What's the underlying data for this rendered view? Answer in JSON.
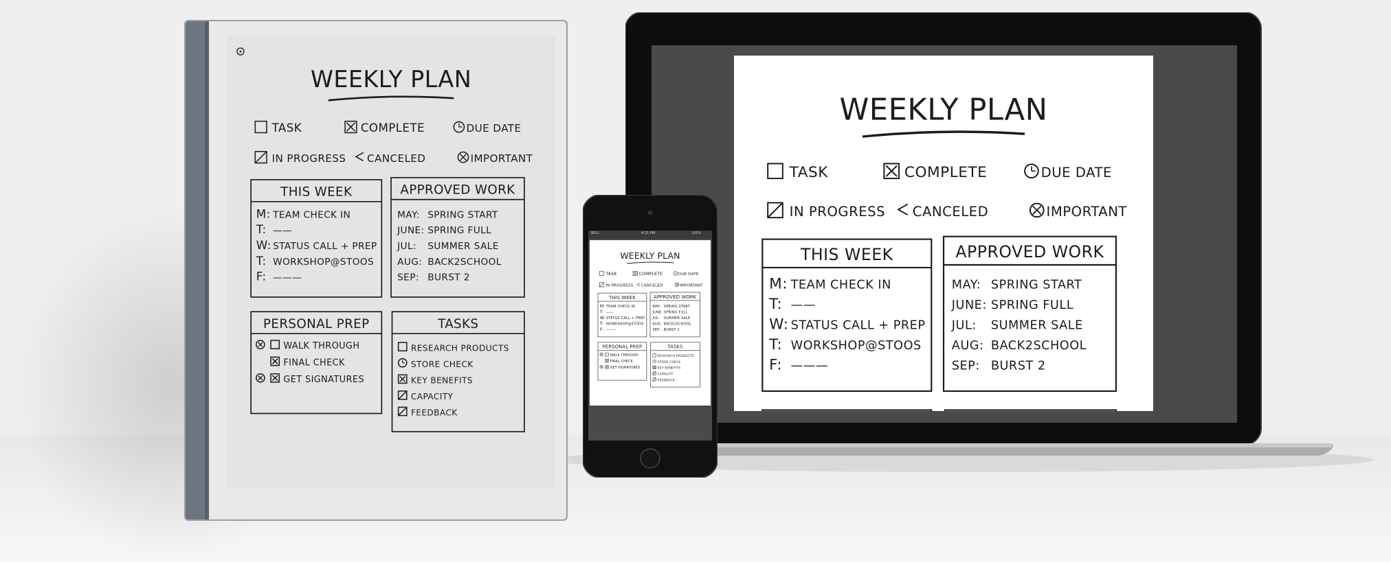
{
  "note": {
    "title": "WEEKLY PLAN",
    "legend": {
      "task": "TASK",
      "complete": "COMPLETE",
      "due_date": "DUE DATE",
      "in_progress": "IN PROGRESS",
      "canceled": "CANCELED",
      "important": "IMPORTANT"
    },
    "this_week": {
      "heading": "THIS WEEK",
      "rows": [
        {
          "day": "M:",
          "text": "TEAM CHECK IN"
        },
        {
          "day": "T:",
          "text": "——"
        },
        {
          "day": "W:",
          "text": "STATUS CALL + PREP"
        },
        {
          "day": "T:",
          "text": "WORKSHOP@STOOS"
        },
        {
          "day": "F:",
          "text": "———"
        }
      ]
    },
    "approved_work": {
      "heading": "APPROVED WORK",
      "rows": [
        {
          "month": "MAY:",
          "text": "SPRING START"
        },
        {
          "month": "JUNE:",
          "text": "SPRING FULL"
        },
        {
          "month": "JUL:",
          "text": "SUMMER SALE"
        },
        {
          "month": "AUG:",
          "text": "BACK2SCHOOL"
        },
        {
          "month": "SEP:",
          "text": "BURST 2"
        }
      ]
    },
    "personal_prep": {
      "heading": "PERSONAL PREP",
      "items": [
        "WALK THROUGH",
        "FINAL CHECK",
        "GET SIGNATURES"
      ]
    },
    "tasks": {
      "heading": "TASKS",
      "items": [
        "RESEARCH PRODUCTS",
        "STORE CHECK",
        "KEY BENEFITS",
        "CAPACITY",
        "FEEDBACK"
      ]
    }
  },
  "phone_status": {
    "carrier": "BELL",
    "time": "4:21 PM",
    "battery": "100%"
  },
  "colors": {
    "background": "#f0f0f0",
    "ink": "#1c1c1c",
    "tablet_paper": "#e6e7e8",
    "tablet_spine": "#6d7680",
    "laptop_bezel": "#0d0d0d",
    "laptop_screen_bg": "#4a4a4a"
  }
}
